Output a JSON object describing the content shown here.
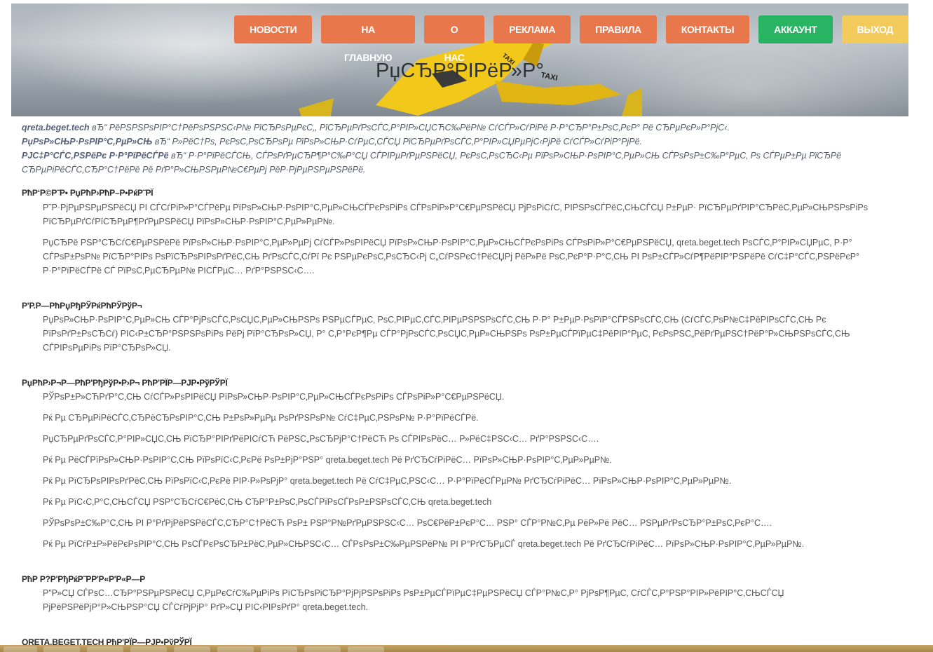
{
  "nav": {
    "items": [
      "НОВОСТИ",
      "НА ГЛАВНУЮ",
      "О НАС",
      "РЕКЛАМА",
      "ПРАВИЛА",
      "КОНТАКТЫ"
    ],
    "account": "АККАУНТ",
    "logout": "ВЫХОД"
  },
  "hero": {
    "title": "РџСЂР°РІРёР»Р°"
  },
  "intro": {
    "p1_lead": "qreta.beget.tech",
    "p1_rest": " вЂ“ РёРЅРЅРѕРІР°С†РёРѕРЅРЅС‹Р№ РїСЂРѕРµРєС‚, РїСЂРµРґРѕСЃС‚Р°РІР»СЏСЋС‰РёР№ СѓСЃР»СѓРіРё Р·Р°СЂР°Р±РѕС‚РєР° Рё СЂРµРєР»Р°РјС‹.",
    "p2_lead": "РџРѕР»СЊР·РѕРІР°С‚РµР»СЊ",
    "p2_rest": " вЂ“ Р»РёС†Рѕ, РєРѕС‚РѕСЂРѕРµ РїРѕР»СЊР·СѓРµС‚СЃСЏ РїСЂРµРґРѕСЃС‚Р°РІР»СЏРµРјС‹РјРё СѓСЃР»СѓРіР°РјРё.",
    "p3_lead": "РЈС‡Р°СЃС‚РЅРёРє Р·Р°РїРёСЃРё",
    "p3_rest": " вЂ“ Р·Р°РїРёСЃСЊ, СЃРѕРґРµСЂР¶Р°С‰Р°СЏ СЃРІРµРґРµРЅРёСЏ, РєРѕС‚РѕСЂС‹Рµ РїРѕР»СЊР·РѕРІР°С‚РµР»СЊ СЃРѕРѕР±С‰Р°РµС‚ Рѕ СЃРµР±Рµ РїСЂРё СЂРµРіРёСЃС‚СЂР°С†РёРё Рё РґР°Р»СЊРЅРµР№С€РµРј РёР·РјРµРЅРµРЅРёРё."
  },
  "sections": [
    {
      "heading": "РћР‘Р©Р˜Р• РџРћР›РћР–Р•РќР˜РЇ",
      "paragraphs": [
        "Р˜Р·РјРµРЅРµРЅРёСЏ РІ СЃСѓРіР»Р°СЃРёРµ РїРѕР»СЊР·РѕРІР°С‚РµР»СЊСЃРєРѕРіРѕ СЃРѕРіР»Р°С€РµРЅРёСЏ РјРѕРіСѓС‚ РІРЅРѕСЃРёС‚СЊСЃСЏ Р±РµР· РїСЂРµРґРІР°СЂРёС‚РµР»СЊРЅРѕРіРѕ РїСЂРµРґСѓРїСЂРµР¶РґРµРЅРёСЏ РїРѕР»СЊР·РѕРІР°С‚РµР»РµР№.",
        "РџСЂРё РЅР°СЂСѓС€РµРЅРёРё РїРѕР»СЊР·РѕРІР°С‚РµР»РµРј СѓСЃР»РѕРІРёСЏ РїРѕР»СЊР·РѕРІР°С‚РµР»СЊСЃРєРѕРіРѕ СЃРѕРіР»Р°С€РµРЅРёСЏ, qreta.beget.tech РѕСЃС‚Р°РІР»СЏРµС‚ Р·Р° СЃРѕР±РѕР№ РїСЂР°РІРѕ РѕРїСЂРѕРІРѕРґРёС‚СЊ РґРѕСЃС‚СѓРї Рє РЅРµРєРѕС‚РѕСЂС‹Рј С„СѓРЅРєС†РёСЏРј РёР»Рё РѕС‚РєР°Р·Р°С‚СЊ РІ РѕР±СЃР»СѓР¶РёРІР°РЅРёРё СѓС‡Р°СЃС‚РЅРёРєР° Р·Р°РїРёСЃРё СЃ РїРѕС‚РµСЂРµР№ РІСЃРµС… РґР°РЅРЅС‹С…."
      ]
    },
    {
      "heading": "Р'Р.Р—РћРџРђРЎРќРћРЎРўР¬",
      "paragraphs": [
        "РџРѕР»СЊР·РѕРІР°С‚РµР»СЊ СЃР°РјРѕСЃС‚РѕСЏС‚РµР»СЊРЅРѕ РЅРµСЃРµС‚ РѕС‚РІРµС‚СЃС‚РІРµРЅРЅРѕСЃС‚СЊ Р·Р° Р±РµР·РѕРїР°СЃРЅРѕСЃС‚СЊ (СѓСЃС‚РѕР№С‡РёРІРѕСЃС‚СЊ Рє РїРѕРґР±РѕСЂСѓ) РІС‹Р±СЂР°РЅРЅРѕРіРѕ РёРј РїР°СЂРѕР»СЏ, Р° С‚Р°РєР¶Рµ СЃР°РјРѕСЃС‚РѕСЏС‚РµР»СЊРЅРѕ РѕР±РµСЃРїРµС‡РёРІР°РµС‚ РєРѕРЅС„РёРґРµРЅС†РёР°Р»СЊРЅРѕСЃС‚СЊ СЃРІРѕРµРіРѕ РїР°СЂРѕР»СЏ."
      ]
    },
    {
      "heading": "РџРћР›Р¬Р—РћР'РђРўР•Р›Р¬ РћР'РЇР—РЈР•РўРЎРЇ",
      "paragraphs": [
        "РЎРѕР±Р»СЋРґР°С‚СЊ СѓСЃР»РѕРІРёСЏ РїРѕР»СЊР·РѕРІР°С‚РµР»СЊСЃРєРѕРіРѕ СЃРѕРіР»Р°С€РµРЅРёСЏ.",
        "Рќ Рµ СЂРµРіРёСЃС‚СЂРёСЂРѕРІР°С‚СЊ Р±РѕР»РµРµ РѕРґРЅРѕР№ СѓС‡РµС‚РЅРѕР№ Р·Р°РїРёСЃРё.",
        "РџСЂРµРґРѕСЃС‚Р°РІР»СЏС‚СЊ РїСЂР°РІРґРёРІСѓСЋ РёРЅС„РѕСЂРјР°С†РёСЋ Рѕ СЃРІРѕРёС… Р»РёС‡РЅС‹С… РґР°РЅРЅС‹С….",
        "Рќ Рµ РёСЃРїРѕР»СЊР·РѕРІР°С‚СЊ РїРѕРїС‹С‚РєРё РѕР±РјР°РЅР° qreta.beget.tech Рё РґСЂСѓРіРёС… РїРѕР»СЊР·РѕРІР°С‚РµР»РµР№.",
        "Рќ Рµ РїСЂРѕРІРѕРґРёС‚СЊ РїРѕРїС‹С‚РєРё РІР·Р»РѕРјР° qreta.beget.tech Рё СѓС‡РµС‚РЅС‹С… Р·Р°РїРёСЃРµР№ РґСЂСѓРіРёС… РїРѕР»СЊР·РѕРІР°С‚РµР»РµР№.",
        "Рќ Рµ РїС‹С‚Р°С‚СЊСЃСЏ РЅР°СЂСѓС€РёС‚СЊ СЂР°Р±РѕС‚РѕСЃРїРѕСЃРѕР±РЅРѕСЃС‚СЊ qreta.beget.tech",
        "РЎРѕРѕР±С‰Р°С‚СЊ РІ Р°РґРјРёРЅРёСЃС‚СЂР°С†РёСЋ РѕР± РЅР°Р№РґРµРЅРЅС‹С… РѕС€РёР±РєР°С… РЅР° СЃР°Р№С‚Рµ РёР»Рё РёС… РЅРµРґРѕСЂР°Р±РѕС‚РєР°С….",
        "Рќ Рµ РїСѓР±Р»РёРєРѕРІР°С‚СЊ РѕСЃРєРѕСЂР±РёС‚РµР»СЊРЅС‹С… СЃРѕРѕР±С‰РµРЅРёР№ РІ Р°РґСЂРµСЃ qreta.beget.tech Рё РґСЂСѓРіРёС… РїРѕР»СЊР·РѕРІР°С‚РµР»РµР№."
      ]
    },
    {
      "heading": "РћР Р?Р'РђРќР˜Р­Р'Р«Р'Р«Р—Р",
      "paragraphs": [
        "Р”Р»СЏ СЃРѕС…СЂР°РЅРµРЅРёСЏ С‚РµРєСѓС‰РµРіРѕ РїСЂРѕРіСЂР°РјРјРЅРѕРіРѕ РѕР±РµСЃРїРµС‡РµРЅРёСЏ СЃР°Р№С‚Р° РјРѕР¶РµС‚ СѓСЃС‚Р°РЅР°РІР»РёРІР°С‚СЊСЃСЏ РјРёРЅРёРјР°Р»СЊРЅР°СЏ СЃСѓРјРјР° РґР»СЏ РІС‹РІРѕРґР° qreta.beget.tech."
      ]
    },
    {
      "heading": "QRETA.BEGET.TECH РћР'РЇР—РЈР•РўРЎРЇ",
      "paragraphs": []
    }
  ]
}
